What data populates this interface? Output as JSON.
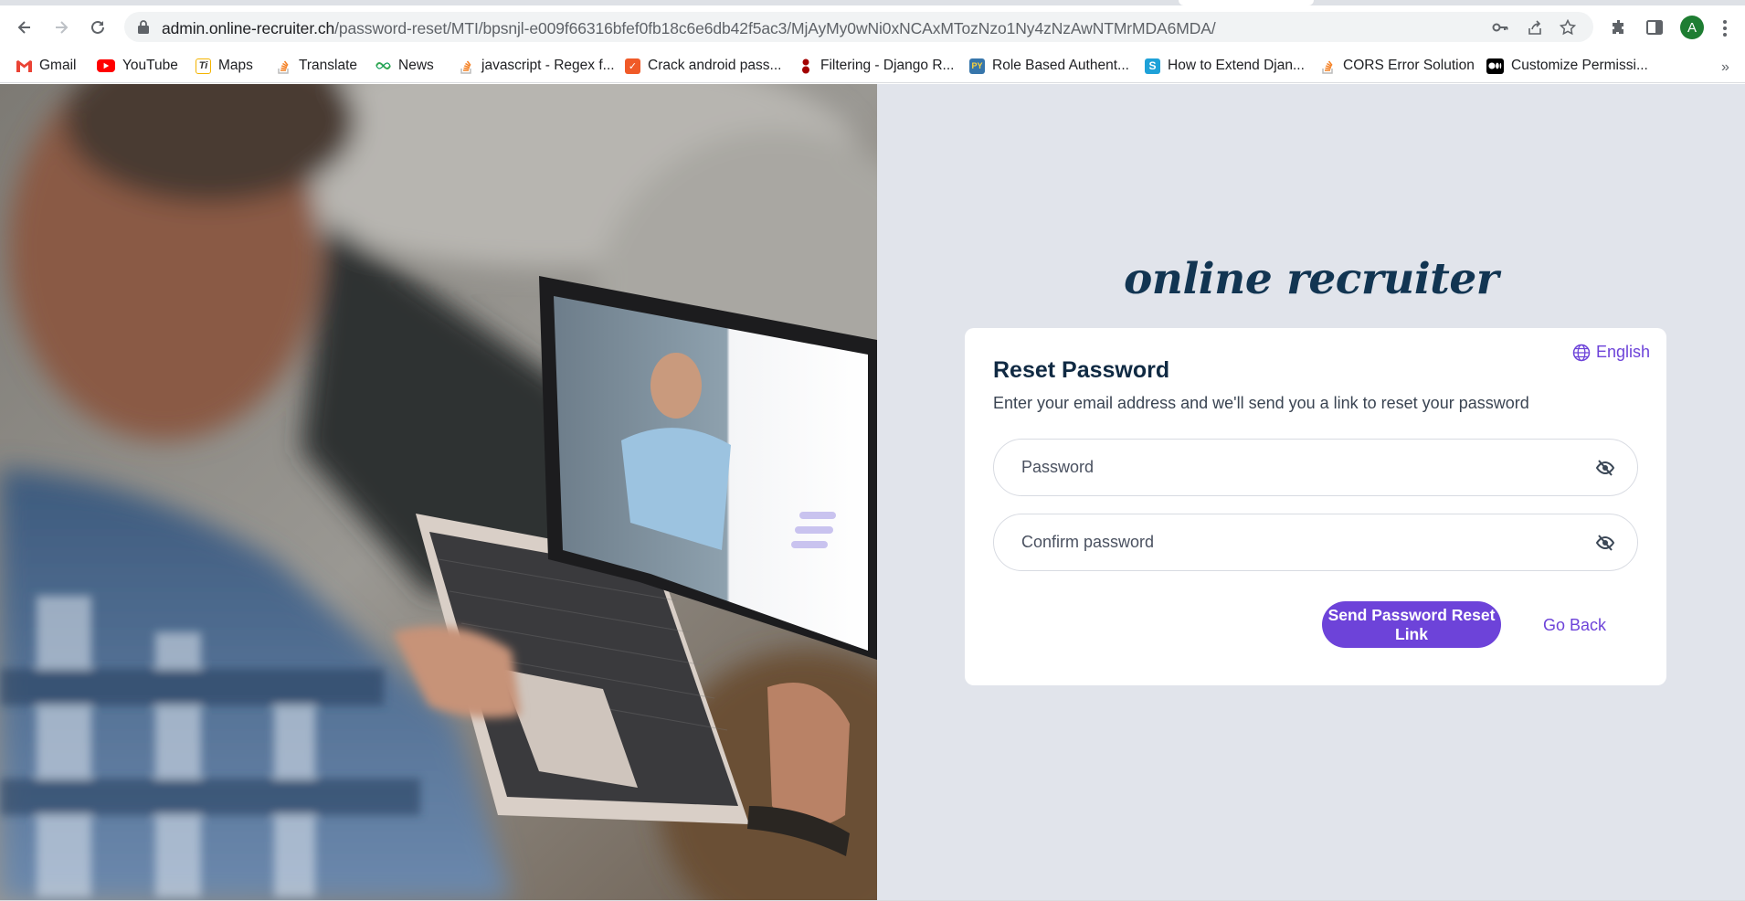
{
  "browser": {
    "url_domain": "admin.online-recruiter.ch",
    "url_path": "/password-reset/MTI/bpsnjl-e009f66316bfef0fb18c6e6db42f5ac3/MjAyMy0wNi0xNCAxMTozNzo1Ny4zNzAwNTMrMDA6MDA/",
    "profile_initial": "A",
    "bookmarks": [
      {
        "label": "Gmail",
        "icon": "gmail-icon",
        "color": "#ea4335"
      },
      {
        "label": "YouTube",
        "icon": "youtube-icon",
        "color": "#ff0000"
      },
      {
        "label": "Maps",
        "icon": "maps-icon",
        "color": "#f4b400"
      },
      {
        "label": "Translate",
        "icon": "stackoverflow-icon",
        "color": "#f48024"
      },
      {
        "label": "News",
        "icon": "news-icon",
        "color": "#34a853"
      },
      {
        "label": "javascript - Regex f...",
        "icon": "stackoverflow-icon",
        "color": "#f48024"
      },
      {
        "label": "Crack android pass...",
        "icon": "shield-icon",
        "color": "#f05a28"
      },
      {
        "label": "Filtering - Django R...",
        "icon": "django-rest-icon",
        "color": "#a30000"
      },
      {
        "label": "Role Based Authent...",
        "icon": "python-icon",
        "color": "#3776ab"
      },
      {
        "label": "How to Extend Djan...",
        "icon": "s-icon",
        "color": "#1ea1d8"
      },
      {
        "label": "CORS Error Solution",
        "icon": "stackoverflow-icon",
        "color": "#f48024"
      },
      {
        "label": "Customize Permissi...",
        "icon": "medium-icon",
        "color": "#000000"
      }
    ]
  },
  "brand": {
    "logo_text": "online recruiter"
  },
  "card": {
    "language": "English",
    "title": "Reset Password",
    "subtitle": "Enter your email address and we'll send you a link to reset your password",
    "password_placeholder": "Password",
    "confirm_placeholder": "Confirm password",
    "submit_label": "Send Password Reset Link",
    "back_label": "Go Back"
  },
  "colors": {
    "accent": "#6d43d9",
    "brand_navy": "#123552",
    "pane_bg": "#e1e4eb"
  }
}
